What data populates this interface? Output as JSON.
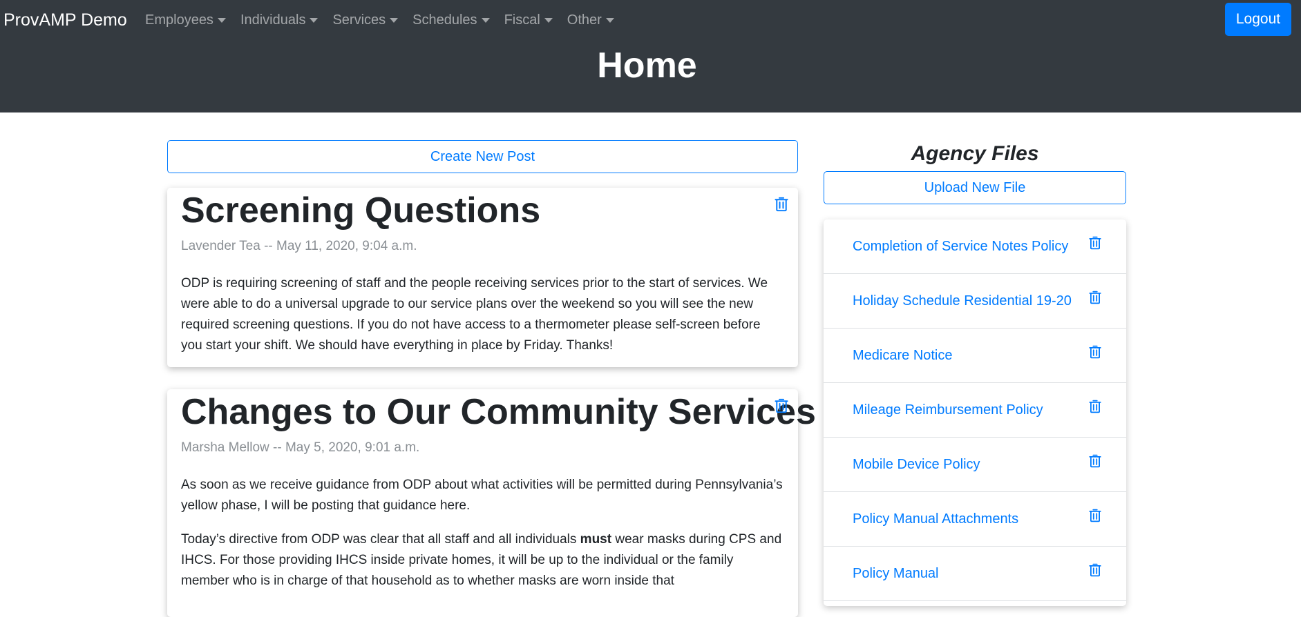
{
  "header": {
    "brand": "ProvAMP Demo",
    "nav": [
      {
        "label": "Employees"
      },
      {
        "label": "Individuals"
      },
      {
        "label": "Services"
      },
      {
        "label": "Schedules"
      },
      {
        "label": "Fiscal"
      },
      {
        "label": "Other"
      }
    ],
    "logout_label": "Logout",
    "page_title": "Home"
  },
  "posts_panel": {
    "create_label": "Create New Post",
    "posts": [
      {
        "title": "Screening Questions",
        "meta": "Lavender Tea -- May 11, 2020, 9:04 a.m.",
        "paragraphs": [
          "ODP is requiring screening of staff and the people receiving services prior to the start of services. We were able to do a universal upgrade to our service plans over the weekend so you will see the new required screening questions. If you do not have access to a thermometer please self-screen before you start your shift. We should have everything in place by Friday. Thanks!"
        ]
      },
      {
        "title": "Changes to Our Community Services",
        "meta": "Marsha Mellow -- May 5, 2020, 9:01 a.m.",
        "p1": "As soon as we receive guidance from ODP about what activities will be permitted during Pennsylvania’s yellow phase, I will be posting that guidance here.",
        "p2_before": "Today’s directive from ODP was clear that all staff and all individuals ",
        "p2_bold": "must",
        "p2_after": " wear masks during CPS and IHCS.  For those providing IHCS inside private homes, it will be up to the individual or the family member who is in charge of that household as to whether masks are worn inside that"
      }
    ]
  },
  "files_panel": {
    "title": "Agency Files",
    "upload_label": "Upload New File",
    "files": [
      {
        "name": "Completion of Service Notes Policy"
      },
      {
        "name": "Holiday Schedule Residential 19-20"
      },
      {
        "name": "Medicare Notice"
      },
      {
        "name": "Mileage Reimbursement Policy"
      },
      {
        "name": "Mobile Device Policy"
      },
      {
        "name": "Policy Manual Attachments"
      },
      {
        "name": "Policy Manual"
      }
    ]
  },
  "colors": {
    "header_bg": "#343a40",
    "primary": "#007bff",
    "muted_text": "#8a8f94"
  },
  "icons": {
    "nav_caret": "caret-down-icon",
    "delete": "trash-icon"
  }
}
